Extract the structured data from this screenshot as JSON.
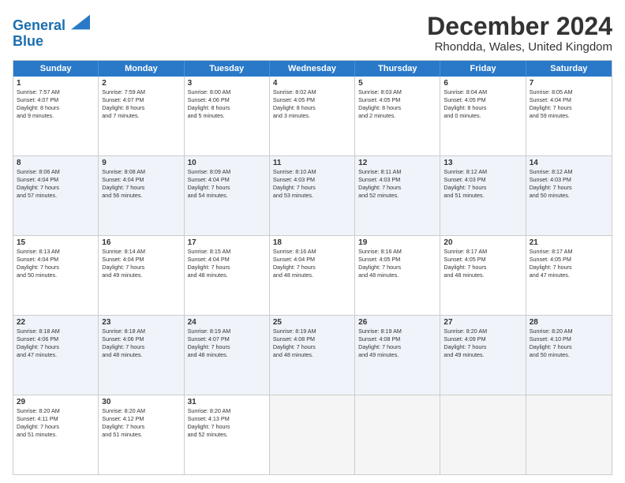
{
  "header": {
    "logo_line1": "General",
    "logo_line2": "Blue",
    "title": "December 2024",
    "subtitle": "Rhondda, Wales, United Kingdom"
  },
  "calendar": {
    "days_of_week": [
      "Sunday",
      "Monday",
      "Tuesday",
      "Wednesday",
      "Thursday",
      "Friday",
      "Saturday"
    ],
    "weeks": [
      {
        "alt": false,
        "cells": [
          {
            "day": "1",
            "text": "Sunrise: 7:57 AM\nSunset: 4:07 PM\nDaylight: 8 hours\nand 9 minutes."
          },
          {
            "day": "2",
            "text": "Sunrise: 7:59 AM\nSunset: 4:07 PM\nDaylight: 8 hours\nand 7 minutes."
          },
          {
            "day": "3",
            "text": "Sunrise: 8:00 AM\nSunset: 4:06 PM\nDaylight: 8 hours\nand 5 minutes."
          },
          {
            "day": "4",
            "text": "Sunrise: 8:02 AM\nSunset: 4:05 PM\nDaylight: 8 hours\nand 3 minutes."
          },
          {
            "day": "5",
            "text": "Sunrise: 8:03 AM\nSunset: 4:05 PM\nDaylight: 8 hours\nand 2 minutes."
          },
          {
            "day": "6",
            "text": "Sunrise: 8:04 AM\nSunset: 4:05 PM\nDaylight: 8 hours\nand 0 minutes."
          },
          {
            "day": "7",
            "text": "Sunrise: 8:05 AM\nSunset: 4:04 PM\nDaylight: 7 hours\nand 59 minutes."
          }
        ]
      },
      {
        "alt": true,
        "cells": [
          {
            "day": "8",
            "text": "Sunrise: 8:06 AM\nSunset: 4:04 PM\nDaylight: 7 hours\nand 57 minutes."
          },
          {
            "day": "9",
            "text": "Sunrise: 8:08 AM\nSunset: 4:04 PM\nDaylight: 7 hours\nand 56 minutes."
          },
          {
            "day": "10",
            "text": "Sunrise: 8:09 AM\nSunset: 4:04 PM\nDaylight: 7 hours\nand 54 minutes."
          },
          {
            "day": "11",
            "text": "Sunrise: 8:10 AM\nSunset: 4:03 PM\nDaylight: 7 hours\nand 53 minutes."
          },
          {
            "day": "12",
            "text": "Sunrise: 8:11 AM\nSunset: 4:03 PM\nDaylight: 7 hours\nand 52 minutes."
          },
          {
            "day": "13",
            "text": "Sunrise: 8:12 AM\nSunset: 4:03 PM\nDaylight: 7 hours\nand 51 minutes."
          },
          {
            "day": "14",
            "text": "Sunrise: 8:12 AM\nSunset: 4:03 PM\nDaylight: 7 hours\nand 50 minutes."
          }
        ]
      },
      {
        "alt": false,
        "cells": [
          {
            "day": "15",
            "text": "Sunrise: 8:13 AM\nSunset: 4:04 PM\nDaylight: 7 hours\nand 50 minutes."
          },
          {
            "day": "16",
            "text": "Sunrise: 8:14 AM\nSunset: 4:04 PM\nDaylight: 7 hours\nand 49 minutes."
          },
          {
            "day": "17",
            "text": "Sunrise: 8:15 AM\nSunset: 4:04 PM\nDaylight: 7 hours\nand 48 minutes."
          },
          {
            "day": "18",
            "text": "Sunrise: 8:16 AM\nSunset: 4:04 PM\nDaylight: 7 hours\nand 48 minutes."
          },
          {
            "day": "19",
            "text": "Sunrise: 8:16 AM\nSunset: 4:05 PM\nDaylight: 7 hours\nand 48 minutes."
          },
          {
            "day": "20",
            "text": "Sunrise: 8:17 AM\nSunset: 4:05 PM\nDaylight: 7 hours\nand 48 minutes."
          },
          {
            "day": "21",
            "text": "Sunrise: 8:17 AM\nSunset: 4:05 PM\nDaylight: 7 hours\nand 47 minutes."
          }
        ]
      },
      {
        "alt": true,
        "cells": [
          {
            "day": "22",
            "text": "Sunrise: 8:18 AM\nSunset: 4:06 PM\nDaylight: 7 hours\nand 47 minutes."
          },
          {
            "day": "23",
            "text": "Sunrise: 8:18 AM\nSunset: 4:06 PM\nDaylight: 7 hours\nand 48 minutes."
          },
          {
            "day": "24",
            "text": "Sunrise: 8:19 AM\nSunset: 4:07 PM\nDaylight: 7 hours\nand 48 minutes."
          },
          {
            "day": "25",
            "text": "Sunrise: 8:19 AM\nSunset: 4:08 PM\nDaylight: 7 hours\nand 48 minutes."
          },
          {
            "day": "26",
            "text": "Sunrise: 8:19 AM\nSunset: 4:08 PM\nDaylight: 7 hours\nand 49 minutes."
          },
          {
            "day": "27",
            "text": "Sunrise: 8:20 AM\nSunset: 4:09 PM\nDaylight: 7 hours\nand 49 minutes."
          },
          {
            "day": "28",
            "text": "Sunrise: 8:20 AM\nSunset: 4:10 PM\nDaylight: 7 hours\nand 50 minutes."
          }
        ]
      },
      {
        "alt": false,
        "cells": [
          {
            "day": "29",
            "text": "Sunrise: 8:20 AM\nSunset: 4:11 PM\nDaylight: 7 hours\nand 51 minutes."
          },
          {
            "day": "30",
            "text": "Sunrise: 8:20 AM\nSunset: 4:12 PM\nDaylight: 7 hours\nand 51 minutes."
          },
          {
            "day": "31",
            "text": "Sunrise: 8:20 AM\nSunset: 4:13 PM\nDaylight: 7 hours\nand 52 minutes."
          },
          {
            "day": "",
            "text": ""
          },
          {
            "day": "",
            "text": ""
          },
          {
            "day": "",
            "text": ""
          },
          {
            "day": "",
            "text": ""
          }
        ]
      }
    ]
  }
}
